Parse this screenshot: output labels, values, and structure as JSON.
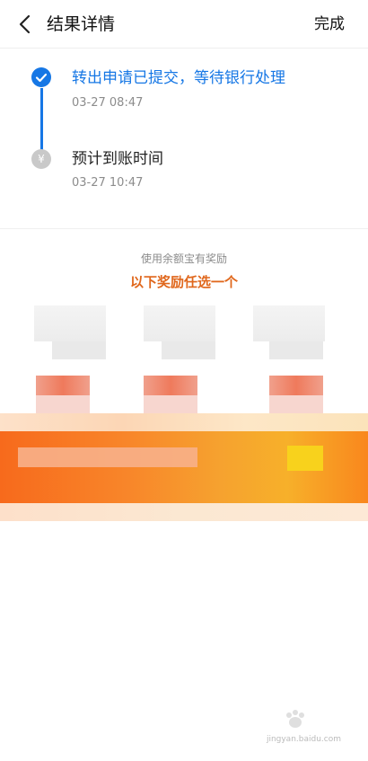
{
  "nav": {
    "title": "结果详情",
    "done": "完成"
  },
  "timeline": {
    "steps": [
      {
        "title": "转出申请已提交，等待银行处理",
        "time": "03-27 08:47",
        "state": "done"
      },
      {
        "title": "预计到账时间",
        "time": "03-27 10:47",
        "state": "pending",
        "icon": "¥"
      }
    ]
  },
  "reward": {
    "subtitle": "使用余额宝有奖励",
    "title": "以下奖励任选一个"
  },
  "watermark": {
    "text": "jingyan.baidu.com"
  },
  "colors": {
    "accent": "#1677e5",
    "reward": "#e0671c",
    "banner": "#f8862a"
  }
}
